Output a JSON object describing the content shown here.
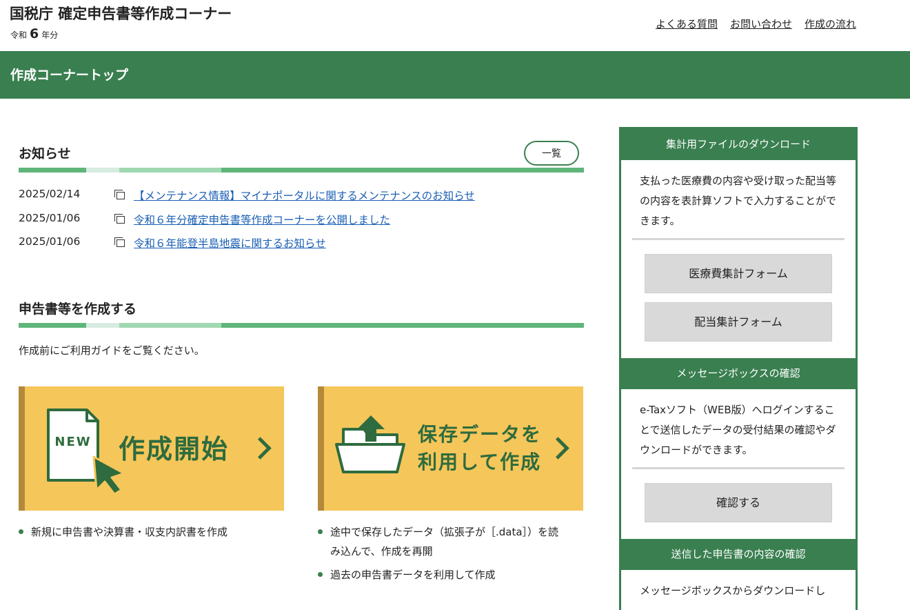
{
  "header": {
    "title": "国税庁 確定申告書等作成コーナー",
    "era_prefix": "令和",
    "era_year": "6",
    "era_suffix": "年分",
    "links": [
      "よくある質問",
      "お問い合わせ",
      "作成の流れ"
    ]
  },
  "page_bar": {
    "title": "作成コーナートップ"
  },
  "news": {
    "title": "お知らせ",
    "list_button": "一覧",
    "items": [
      {
        "date": "2025/02/14",
        "text": "【メンテナンス情報】マイナポータルに関するメンテナンスのお知らせ"
      },
      {
        "date": "2025/01/06",
        "text": "令和６年分確定申告書等作成コーナーを公開しました"
      },
      {
        "date": "2025/01/06",
        "text": "令和６年能登半島地震に関するお知らせ"
      }
    ]
  },
  "create": {
    "title": "申告書等を作成する",
    "guide": "作成前にご利用ガイドをご覧ください。",
    "new_card": {
      "badge": "NEW",
      "label": "作成開始"
    },
    "saved_card": {
      "label_line1": "保存データを",
      "label_line2": "利用して作成"
    },
    "new_bullets": [
      "新規に申告書や決算書・収支内訳書を作成"
    ],
    "saved_bullets": [
      "途中で保存したデータ（拡張子が［.data］）を読み込んで、作成を再開",
      "過去の申告書データを利用して作成"
    ]
  },
  "sidebar": {
    "sections": [
      {
        "head": "集計用ファイルのダウンロード",
        "text": "支払った医療費の内容や受け取った配当等の内容を表計算ソフトで入力することができます。",
        "buttons": [
          "医療費集計フォーム",
          "配当集計フォーム"
        ]
      },
      {
        "head": "メッセージボックスの確認",
        "text": "e-Taxソフト（WEB版）へログインすることで送信したデータの受付結果の確認やダウンロードができます。",
        "buttons": [
          "確認する"
        ]
      },
      {
        "head": "送信した申告書の内容の確認",
        "text": "メッセージボックスからダウンロードし"
      }
    ]
  },
  "colors": {
    "brand_green": "#3a7f50",
    "card_yellow": "#f5c65a",
    "link_blue": "#1a5fb4"
  }
}
